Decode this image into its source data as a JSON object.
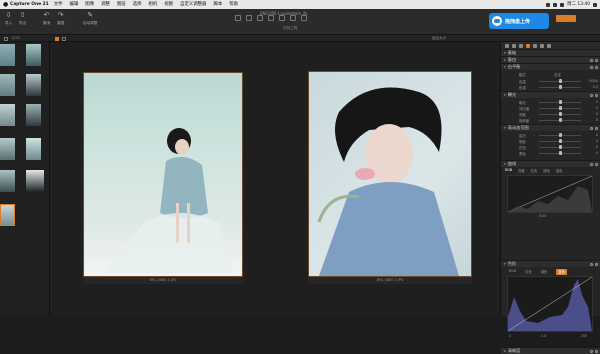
{
  "menubar": {
    "app_name": "Capture One 21",
    "items": [
      "文件",
      "编辑",
      "图像",
      "调整",
      "图层",
      "选择",
      "相机",
      "视图",
      "自定义调整器",
      "脚本",
      "帮助"
    ],
    "clock": "周二 13:40"
  },
  "toolbar": {
    "buttons": [
      {
        "label": "导入",
        "icon": "import-icon"
      },
      {
        "label": "导出",
        "icon": "export-icon"
      },
      {
        "label": "撤消",
        "icon": "undo-icon"
      },
      {
        "label": "重做",
        "icon": "redo-icon"
      },
      {
        "label": "自动调整",
        "icon": "auto-adjust-icon"
      }
    ],
    "doc_title": "ENCORE Lavalestern.ifx",
    "tools_label": "光标工具"
  },
  "subbar": {
    "count": "2/71",
    "zoom_label": "适合大小"
  },
  "badge": {
    "text": "拖拽盘上传"
  },
  "viewer": {
    "left_caption": "IMG_0884 2.JPG",
    "right_caption": "IMG_0880 2.JPG"
  },
  "panel": {
    "sections": [
      {
        "title": "基础"
      },
      {
        "title": "基白"
      },
      {
        "title": "白平衡"
      },
      {
        "title": "曝光"
      },
      {
        "title": "高动态范围"
      },
      {
        "title": "曲线"
      },
      {
        "title": "色阶"
      },
      {
        "title": "清晰度"
      }
    ],
    "wb_rows": [
      {
        "label": "模式",
        "value": "自定"
      },
      {
        "label": "色温",
        "value": "5000"
      },
      {
        "label": "色调",
        "value": "0.0"
      }
    ],
    "exposure_rows": [
      {
        "label": "曝光",
        "value": "0"
      },
      {
        "label": "对比度",
        "value": "0"
      },
      {
        "label": "亮度",
        "value": "0"
      },
      {
        "label": "饱和度",
        "value": "0"
      }
    ],
    "hdr_rows": [
      {
        "label": "高光",
        "value": "0"
      },
      {
        "label": "阴影",
        "value": "0"
      },
      {
        "label": "白色",
        "value": "0"
      },
      {
        "label": "黑色",
        "value": "0"
      }
    ],
    "curve_tabs": [
      "RGB",
      "亮度",
      "红色",
      "绿色",
      "蓝色"
    ],
    "curve_value": "0.00",
    "level_tabs": [
      "RGB",
      "红色",
      "绿色",
      "蓝色"
    ],
    "level_left": "0",
    "level_right": "255",
    "level_mid": "1.0"
  },
  "colors": {
    "accent": "#d97d28",
    "badge": "#1e88e5"
  }
}
